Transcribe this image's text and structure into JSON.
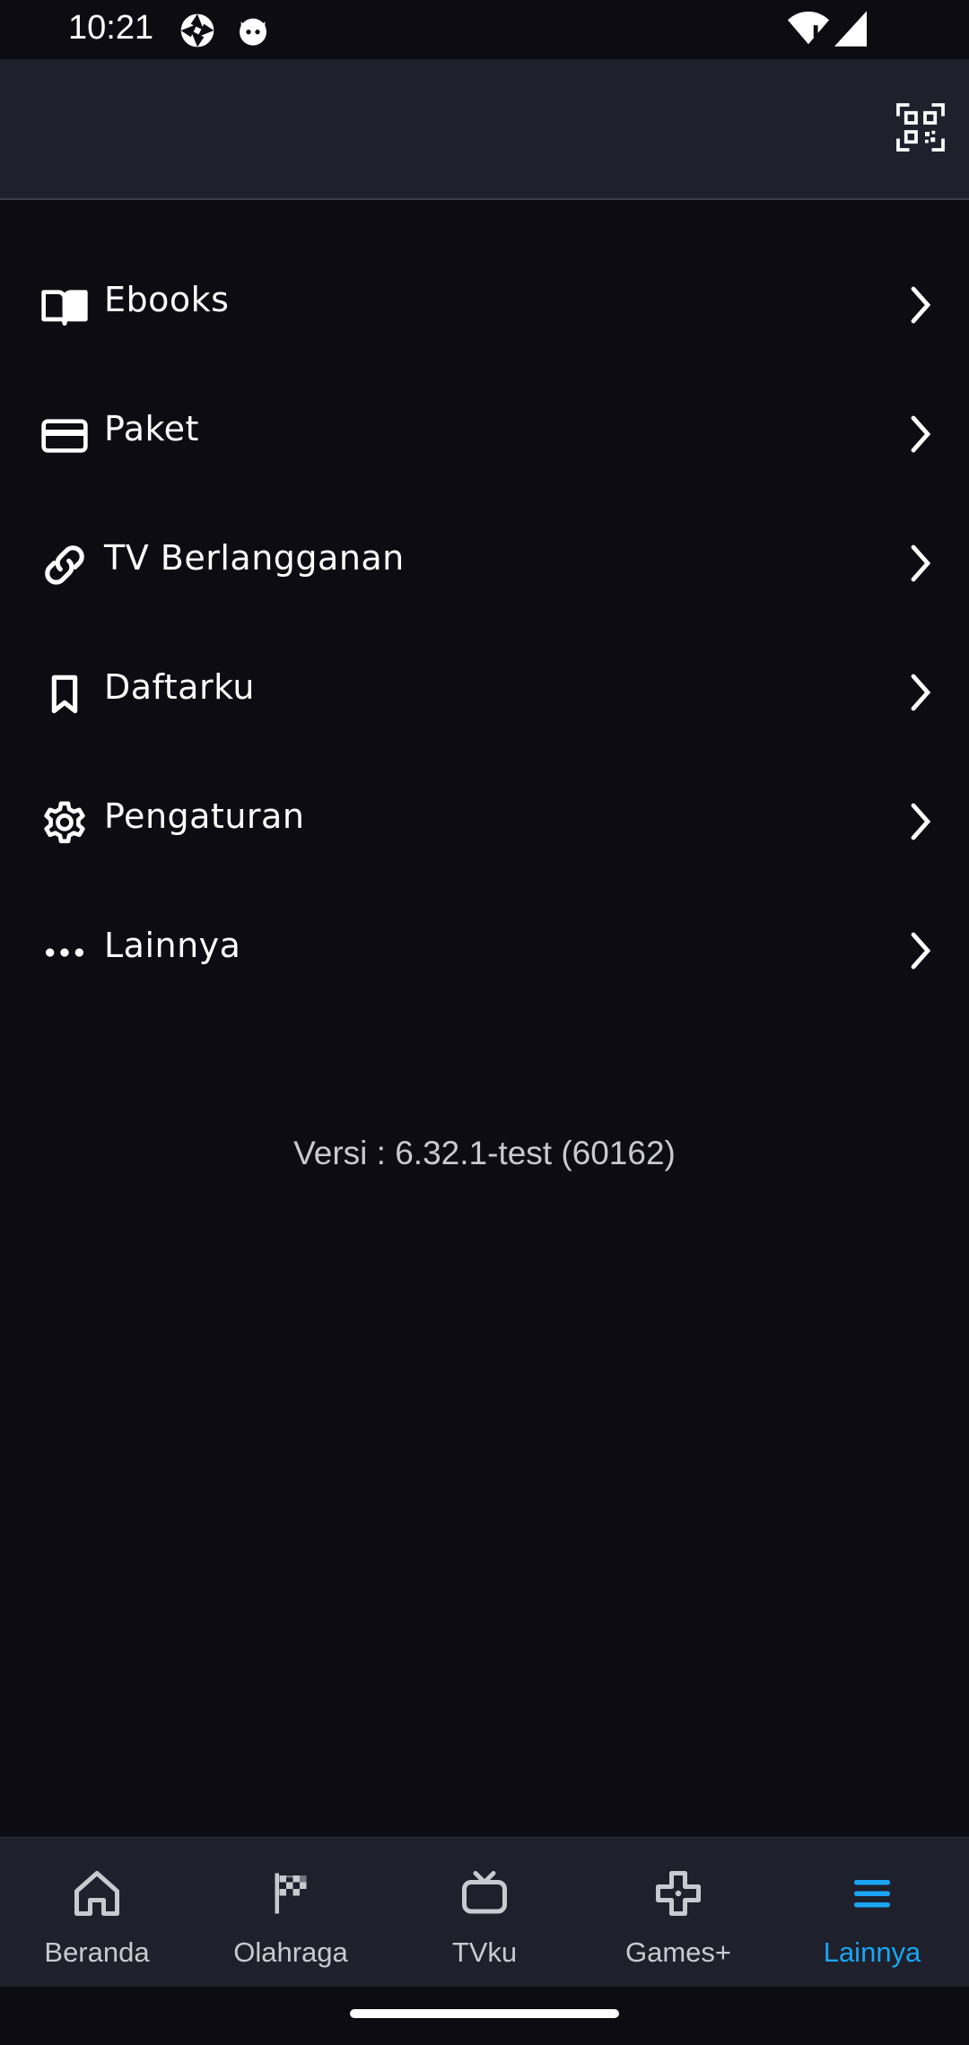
{
  "status_bar": {
    "time": "10:21",
    "icons": [
      "aperture-icon",
      "cat-face-icon",
      "wifi-icon",
      "signal-icon"
    ]
  },
  "header": {
    "qr_icon": "qr-scan-icon"
  },
  "menu": {
    "items": [
      {
        "label": "Ebooks",
        "icon": "book-icon"
      },
      {
        "label": "Paket",
        "icon": "card-icon"
      },
      {
        "label": "TV Berlangganan",
        "icon": "link-icon"
      },
      {
        "label": "Daftarku",
        "icon": "bookmark-icon"
      },
      {
        "label": "Pengaturan",
        "icon": "gear-icon"
      },
      {
        "label": "Lainnya",
        "icon": "more-dots-icon"
      }
    ]
  },
  "version_text": "Versi : 6.32.1-test (60162)",
  "bottom_nav": {
    "active_color": "#1aa5f5",
    "items": [
      {
        "label": "Beranda",
        "icon": "home-icon"
      },
      {
        "label": "Olahraga",
        "icon": "flag-icon"
      },
      {
        "label": "TVku",
        "icon": "tv-icon"
      },
      {
        "label": "Games+",
        "icon": "gamepad-icon"
      },
      {
        "label": "Lainnya",
        "icon": "menu-icon",
        "active": true
      }
    ]
  }
}
